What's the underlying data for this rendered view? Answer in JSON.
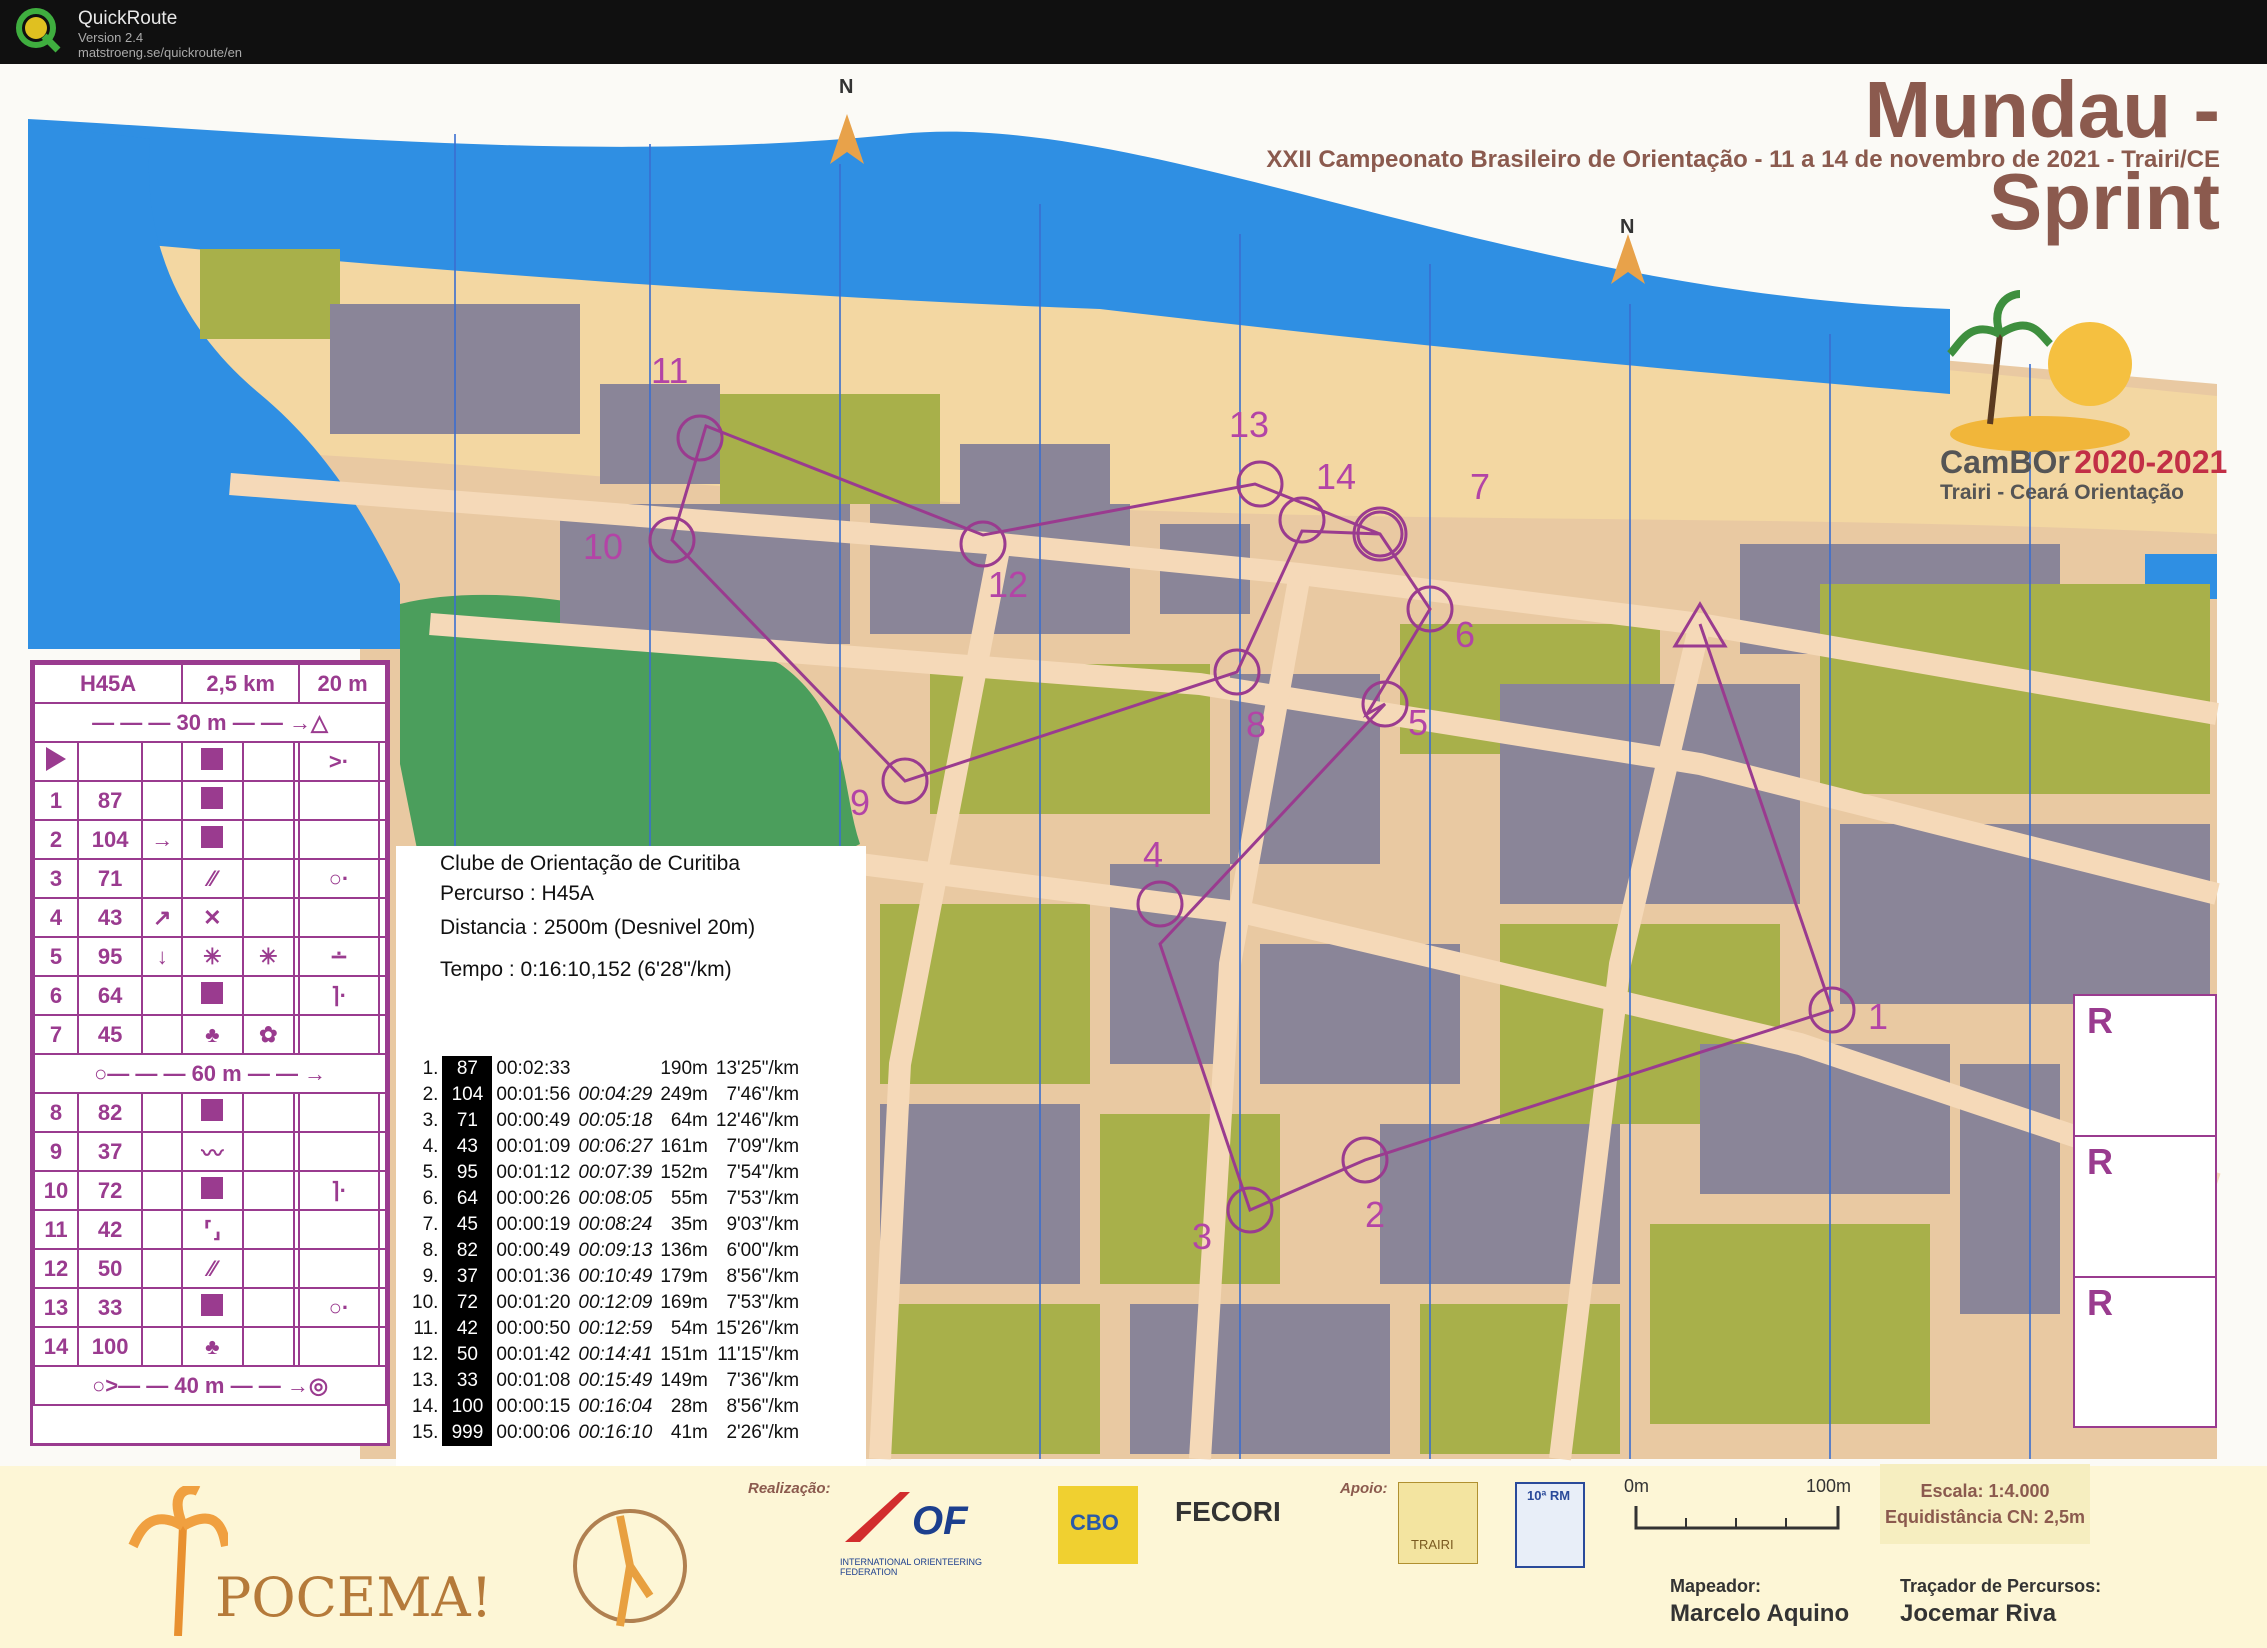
{
  "app": {
    "name": "QuickRoute",
    "version": "Version 2.4",
    "url": "matstroeng.se/quickroute/en"
  },
  "map": {
    "title": "Mundau - Sprint",
    "subtitle": "XXII Campeonato Brasileiro de Orientação - 11 a 14 de novembro de 2021 - Trairi/CE",
    "north_label": "N",
    "logo": {
      "name": "CamBOr",
      "years": "2020-2021",
      "sub": "Trairi - Ceará  Orientação"
    },
    "control_labels": [
      "1",
      "2",
      "3",
      "4",
      "5",
      "6",
      "7",
      "8",
      "9",
      "10",
      "11",
      "12",
      "13",
      "14"
    ],
    "colors": {
      "sea": "#2f8fe3",
      "beach": "#f3d7a2",
      "building": "#8a8598",
      "vegetation": "#a8b04a",
      "forest": "#4b9e5c",
      "course": "#9a3b8f",
      "road": "#f5d9b8"
    }
  },
  "description": {
    "header": {
      "course": "H45A",
      "length": "2,5 km",
      "climb": "20 m"
    },
    "start_leg": "30 m",
    "rows": [
      {
        "n": "1",
        "code": "87"
      },
      {
        "n": "2",
        "code": "104",
        "dir": "→"
      },
      {
        "n": "3",
        "code": "71"
      },
      {
        "n": "4",
        "code": "43",
        "dir": "↗"
      },
      {
        "n": "5",
        "code": "95",
        "dir": "↓"
      },
      {
        "n": "6",
        "code": "64"
      },
      {
        "n": "7",
        "code": "45"
      }
    ],
    "mid_leg": "60 m",
    "rows2": [
      {
        "n": "8",
        "code": "82"
      },
      {
        "n": "9",
        "code": "37"
      },
      {
        "n": "10",
        "code": "72"
      },
      {
        "n": "11",
        "code": "42"
      },
      {
        "n": "12",
        "code": "50"
      },
      {
        "n": "13",
        "code": "33"
      },
      {
        "n": "14",
        "code": "100"
      }
    ],
    "finish_leg": "40 m"
  },
  "info": {
    "club": "Clube de Orientação de Curitiba",
    "course": "Percurso : H45A",
    "distance": "Distancia : 2500m (Desnivel 20m)",
    "time": "Tempo : 0:16:10,152 (6'28\"/km)",
    "splits": [
      [
        "1.",
        "87",
        "00:02:33",
        "",
        "190m",
        "13'25\"/km"
      ],
      [
        "2.",
        "104",
        "00:01:56",
        "00:04:29",
        "249m",
        "7'46\"/km"
      ],
      [
        "3.",
        "71",
        "00:00:49",
        "00:05:18",
        "64m",
        "12'46\"/km"
      ],
      [
        "4.",
        "43",
        "00:01:09",
        "00:06:27",
        "161m",
        "7'09\"/km"
      ],
      [
        "5.",
        "95",
        "00:01:12",
        "00:07:39",
        "152m",
        "7'54\"/km"
      ],
      [
        "6.",
        "64",
        "00:00:26",
        "00:08:05",
        "55m",
        "7'53\"/km"
      ],
      [
        "7.",
        "45",
        "00:00:19",
        "00:08:24",
        "35m",
        "9'03\"/km"
      ],
      [
        "8.",
        "82",
        "00:00:49",
        "00:09:13",
        "136m",
        "6'00\"/km"
      ],
      [
        "9.",
        "37",
        "00:01:36",
        "00:10:49",
        "179m",
        "8'56\"/km"
      ],
      [
        "10.",
        "72",
        "00:01:20",
        "00:12:09",
        "169m",
        "7'53\"/km"
      ],
      [
        "11.",
        "42",
        "00:00:50",
        "00:12:59",
        "54m",
        "15'26\"/km"
      ],
      [
        "12.",
        "50",
        "00:01:42",
        "00:14:41",
        "151m",
        "11'15\"/km"
      ],
      [
        "13.",
        "33",
        "00:01:08",
        "00:15:49",
        "149m",
        "7'36\"/km"
      ],
      [
        "14.",
        "100",
        "00:00:15",
        "00:16:04",
        "28m",
        "8'56\"/km"
      ],
      [
        "15.",
        "999",
        "00:00:06",
        "00:16:10",
        "41m",
        "2'26\"/km"
      ]
    ]
  },
  "rboxes": [
    "R",
    "R",
    "R"
  ],
  "footer": {
    "realizacao": "Realização:",
    "apoio": "Apoio:",
    "iof": "INTERNATIONAL ORIENTEERING FEDERATION",
    "cbo": "CBO",
    "fecori": "FECORI",
    "trairi": "TRAIRI",
    "rm": "10ª RM",
    "pocema": "POCEMA!",
    "scale_0": "0m",
    "scale_100": "100m",
    "scale": "Escala: 1:4.000",
    "equid": "Equidistância CN: 2,5m",
    "mapper_role": "Mapeador:",
    "mapper": "Marcelo Aquino",
    "planner_role": "Traçador de Percursos:",
    "planner": "Jocemar Riva"
  }
}
